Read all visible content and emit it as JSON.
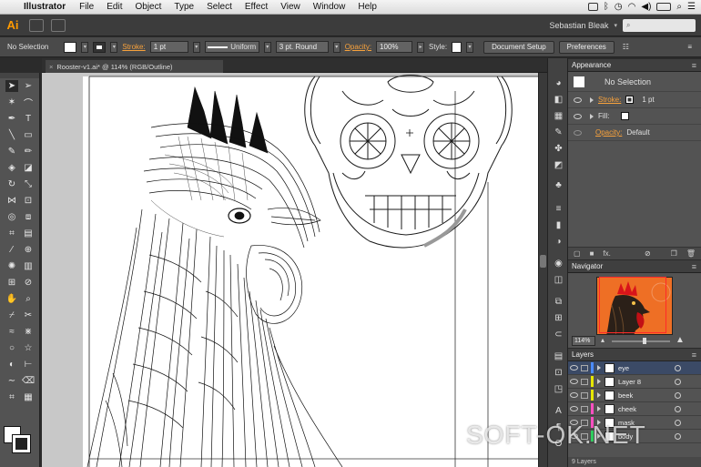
{
  "menubar": {
    "app_name": "Illustrator",
    "items": [
      "File",
      "Edit",
      "Object",
      "Type",
      "Select",
      "Effect",
      "View",
      "Window",
      "Help"
    ]
  },
  "appbar": {
    "logo": "Ai",
    "workspace_user": "Sebastian Bleak",
    "search_placeholder": ""
  },
  "controlbar": {
    "selection_label": "No Selection",
    "stroke_label": "Stroke:",
    "stroke_weight": "1 pt",
    "profile": "Uniform",
    "brush": "3 pt. Round",
    "opacity_label": "Opacity:",
    "opacity_value": "100%",
    "style_label": "Style:",
    "document_setup": "Document Setup",
    "preferences": "Preferences"
  },
  "document": {
    "tab_title": "Rooster-v1.ai* @ 114% (RGB/Outline)",
    "close": "×"
  },
  "appearance": {
    "title": "Appearance",
    "head_label": "No Selection",
    "stroke_label": "Stroke:",
    "stroke_value": "1 pt",
    "fill_label": "Fill:",
    "opacity_label": "Opacity:",
    "opacity_value": "Default",
    "fx": "fx."
  },
  "navigator": {
    "title": "Navigator",
    "zoom": "114%",
    "preview_color": "#ee6f25",
    "view_box_color": "#ff2a2a"
  },
  "layers": {
    "title": "Layers",
    "rows": [
      {
        "name": "eye",
        "color": "#4b8bff",
        "active": true
      },
      {
        "name": "Layer 8",
        "color": "#e6e600",
        "active": false
      },
      {
        "name": "beek",
        "color": "#e6e600",
        "active": false
      },
      {
        "name": "cheek",
        "color": "#ff4fc1",
        "active": false
      },
      {
        "name": "mask",
        "color": "#ff4fc1",
        "active": false
      },
      {
        "name": "body",
        "color": "#2fd05f",
        "active": false
      }
    ],
    "footer": "9 Layers"
  },
  "watermark": "SOFT-OK.NET"
}
